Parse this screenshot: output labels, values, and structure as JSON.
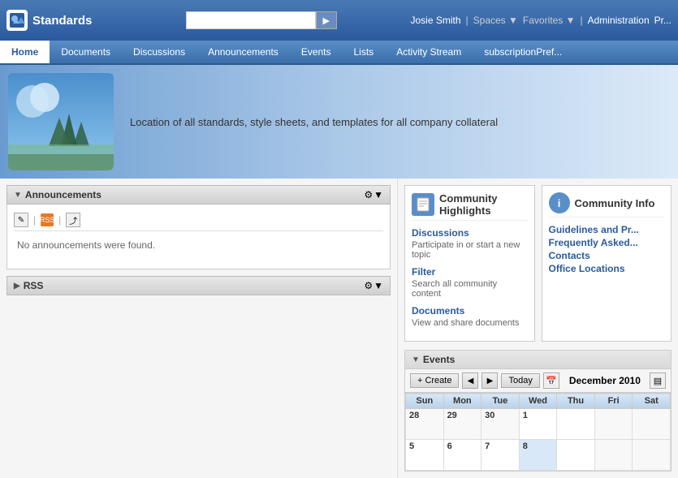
{
  "topbar": {
    "logo_text": "Standards",
    "search_placeholder": "",
    "search_button_label": "▶",
    "user_name": "Josie Smith",
    "spaces_label": "Spaces",
    "favorites_label": "Favorites",
    "administration_label": "Administration",
    "more_label": "Pr..."
  },
  "nav": {
    "tabs": [
      {
        "label": "Home",
        "active": true
      },
      {
        "label": "Documents"
      },
      {
        "label": "Discussions"
      },
      {
        "label": "Announcements"
      },
      {
        "label": "Events"
      },
      {
        "label": "Lists"
      },
      {
        "label": "Activity Stream"
      },
      {
        "label": "subscriptionPref..."
      }
    ]
  },
  "banner": {
    "description": "Location of all standards, style sheets, and templates for all company collateral"
  },
  "announcements": {
    "title": "Announcements",
    "no_content": "No announcements were found.",
    "gear_icon": "⚙",
    "arrow_icon": "▼"
  },
  "rss": {
    "title": "RSS",
    "arrow_icon": "▶",
    "gear_icon": "⚙"
  },
  "community_highlights": {
    "title": "Community Highlights",
    "icon": "📄",
    "links": [
      {
        "label": "Discussions",
        "desc": "Participate in or start a new topic"
      },
      {
        "label": "Filter",
        "desc": "Search all community content"
      },
      {
        "label": "Documents",
        "desc": "View and share documents"
      }
    ]
  },
  "community_info": {
    "title": "Community Info",
    "links": [
      {
        "label": "Guidelines and Pr..."
      },
      {
        "label": "Frequently Asked..."
      },
      {
        "label": "Contacts"
      },
      {
        "label": "Office Locations"
      }
    ]
  },
  "events": {
    "title": "Events",
    "create_label": "Create",
    "today_label": "Today",
    "month_label": "December 2010",
    "arrow_icon": "▼",
    "days": [
      "Sun",
      "Mon",
      "Tue",
      "Wed",
      "Thu",
      "Fri",
      "Sat"
    ],
    "weeks": [
      [
        {
          "date": "28",
          "prev": true,
          "today": false,
          "weekend": false
        },
        {
          "date": "29",
          "prev": true,
          "today": false,
          "weekend": false
        },
        {
          "date": "30",
          "prev": true,
          "today": false,
          "weekend": false
        },
        {
          "date": "1",
          "prev": false,
          "today": false,
          "weekend": false
        },
        {
          "date": "",
          "prev": false,
          "today": false,
          "weekend": false
        },
        {
          "date": "",
          "prev": false,
          "today": false,
          "weekend": true
        },
        {
          "date": "",
          "prev": false,
          "today": false,
          "weekend": true
        }
      ],
      [
        {
          "date": "5",
          "prev": false,
          "today": false,
          "weekend": false
        },
        {
          "date": "6",
          "prev": false,
          "today": false,
          "weekend": false
        },
        {
          "date": "7",
          "prev": false,
          "today": false,
          "weekend": false
        },
        {
          "date": "8",
          "prev": false,
          "today": true,
          "weekend": false
        },
        {
          "date": "",
          "prev": false,
          "today": false,
          "weekend": false
        },
        {
          "date": "",
          "prev": false,
          "today": false,
          "weekend": true
        },
        {
          "date": "",
          "prev": false,
          "today": false,
          "weekend": true
        }
      ]
    ]
  }
}
